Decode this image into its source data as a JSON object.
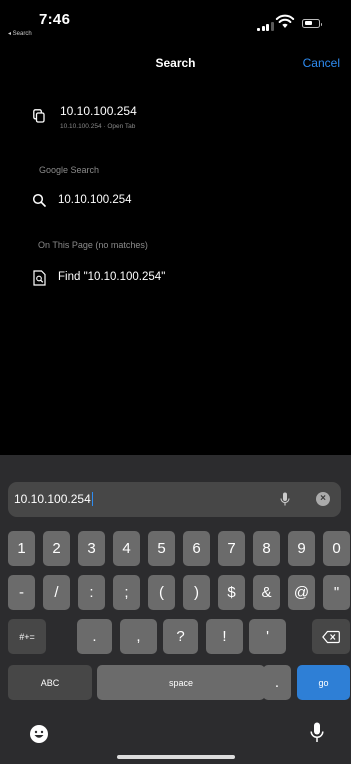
{
  "status": {
    "time": "7:46",
    "back_app": "◂ Search"
  },
  "header": {
    "title": "Search",
    "cancel": "Cancel"
  },
  "results": {
    "open_tab": {
      "title": "10.10.100.254",
      "subtitle": "10.10.100.254 · Open Tab"
    },
    "google_section": "Google Search",
    "google_suggestion": "10.10.100.254",
    "page_section": "On This Page (no matches)",
    "find": "Find \"10.10.100.254\""
  },
  "search_field": {
    "value": "10.10.100.254"
  },
  "keyboard": {
    "row1": [
      "1",
      "2",
      "3",
      "4",
      "5",
      "6",
      "7",
      "8",
      "9",
      "0"
    ],
    "row2": [
      "-",
      "/",
      ":",
      ";",
      "(",
      ")",
      "$",
      "&",
      "@",
      "\""
    ],
    "mode_key": "#+=",
    "row3": [
      ".",
      ",",
      "?",
      "!",
      "'"
    ],
    "abc": "ABC",
    "space": "space",
    "period": ".",
    "go": "go"
  },
  "colors": {
    "accent": "#2e8cf2",
    "go_key": "#2e7fd6",
    "keyboard_bg": "#2c2c2e"
  }
}
